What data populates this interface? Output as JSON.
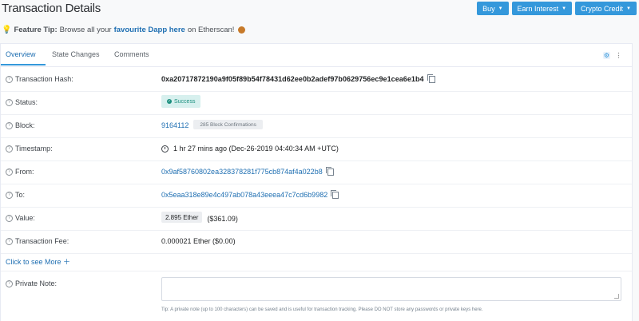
{
  "header": {
    "title": "Transaction Details",
    "buttons": [
      {
        "label": "Buy"
      },
      {
        "label": "Earn Interest"
      },
      {
        "label": "Crypto Credit"
      }
    ]
  },
  "feature_tip": {
    "label": "Feature Tip:",
    "text_before": "Browse all your",
    "link": "favourite Dapp here",
    "text_after": "on Etherscan!"
  },
  "tabs": [
    {
      "label": "Overview",
      "active": true
    },
    {
      "label": "State Changes",
      "active": false
    },
    {
      "label": "Comments",
      "active": false
    }
  ],
  "details": {
    "hash_label": "Transaction Hash:",
    "hash_value": "0xa20717872190a9f05f89b54f78431d62ee0b2adef97b0629756ec9e1cea6e1b4",
    "status_label": "Status:",
    "status_value": "Success",
    "block_label": "Block:",
    "block_value": "9164112",
    "block_confirmations": "285 Block Confirmations",
    "timestamp_label": "Timestamp:",
    "timestamp_value": "1 hr 27 mins ago (Dec-26-2019 04:40:34 AM +UTC)",
    "from_label": "From:",
    "from_value": "0x9af58760802ea328378281f775cb874af4a022b8",
    "to_label": "To:",
    "to_value": "0x5eaa318e89e4c497ab078a43eeea47c7cd6b9982",
    "value_label": "Value:",
    "value_ether": "2.895 Ether",
    "value_usd": "($361.09)",
    "fee_label": "Transaction Fee:",
    "fee_value": "0.000021 Ether ($0.00)",
    "see_more": "Click to see More",
    "private_note_label": "Private Note:",
    "private_note_tip": "Tip: A private note (up to 100 characters) can be saved and is useful for transaction tracking. Please DO NOT store any passwords or private keys here."
  },
  "colors": {
    "accent": "#3498db",
    "link": "#1f6fb2",
    "success": "#1b8f7e"
  }
}
